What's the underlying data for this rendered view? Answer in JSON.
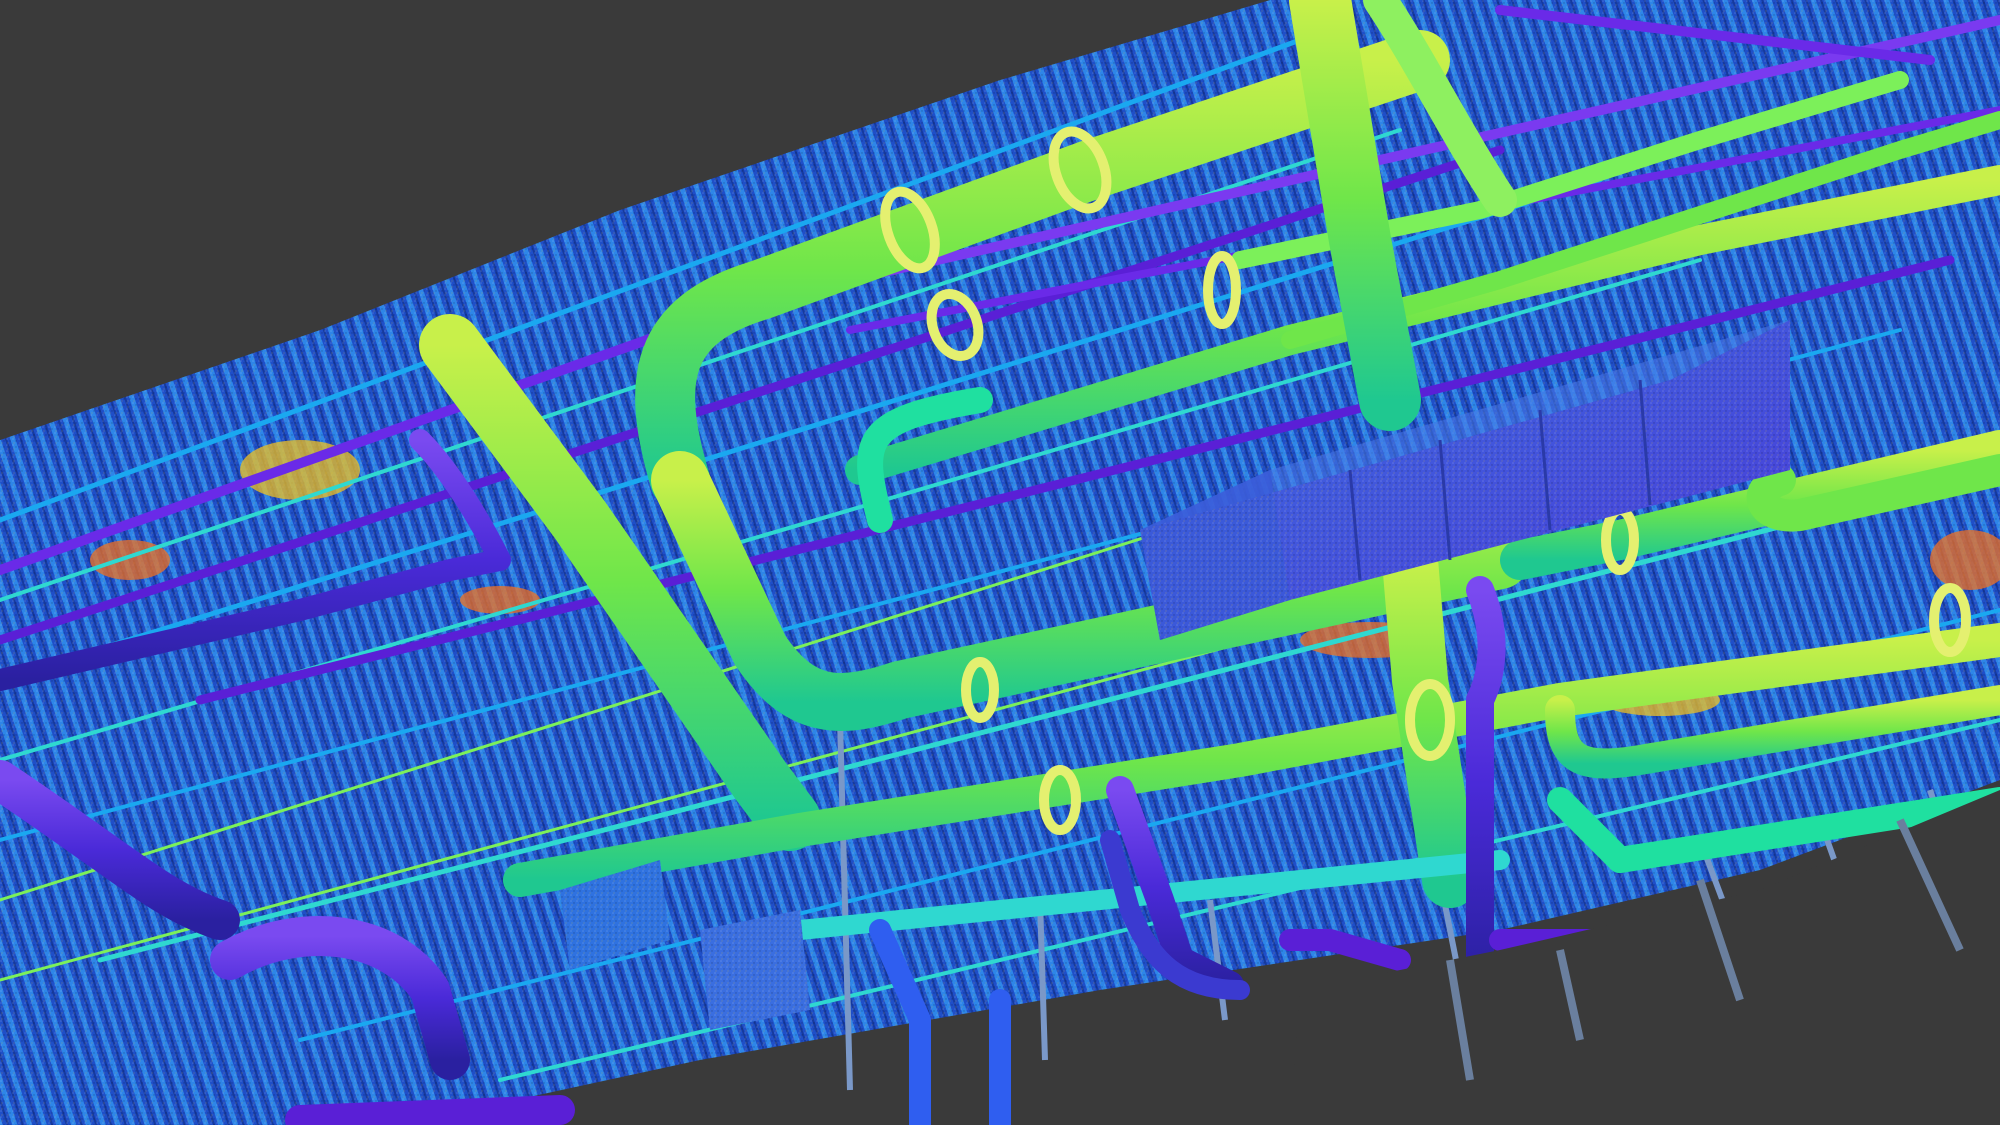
{
  "scene": {
    "background": "#3a3a3a",
    "colormap": [
      "#5a1fd6",
      "#2f5ef0",
      "#1aa8f0",
      "#1fe0a0",
      "#7cf05a",
      "#c8ee3a",
      "#f0c020",
      "#f07020"
    ],
    "content": "point-cloud-pipe-rack"
  }
}
